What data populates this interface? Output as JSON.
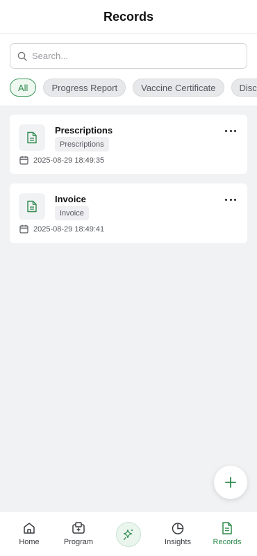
{
  "header": {
    "title": "Records"
  },
  "search": {
    "placeholder": "Search..."
  },
  "filters": [
    "All",
    "Progress Report",
    "Vaccine Certificate",
    "Discharge Summary"
  ],
  "records": [
    {
      "title": "Prescriptions",
      "tag": "Prescriptions",
      "date": "2025-08-29 18:49:35"
    },
    {
      "title": "Invoice",
      "tag": "Invoice",
      "date": "2025-08-29 18:49:41"
    }
  ],
  "nav": {
    "home": "Home",
    "program": "Program",
    "insights": "Insights",
    "records": "Records"
  },
  "colors": {
    "accent": "#2f8a4d",
    "background": "#f1f2f4"
  }
}
